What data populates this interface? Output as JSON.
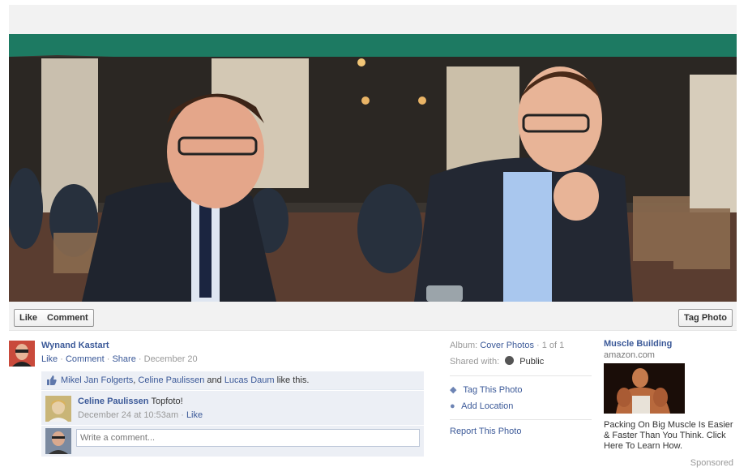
{
  "photo": {
    "alt": "Photo"
  },
  "actions": {
    "like_label": "Like",
    "comment_label": "Comment",
    "tag_photo_label": "Tag Photo"
  },
  "owner": {
    "name": "Wynand Kastart",
    "like_link": "Like",
    "comment_link": "Comment",
    "share_link": "Share",
    "date": "December 20",
    "dot": "·"
  },
  "likes": {
    "people": [
      "Mikel Jan Folgerts",
      "Celine Paulissen",
      "Lucas Daum"
    ],
    "comma": ",",
    "and_text": "and",
    "suffix": "like this."
  },
  "comment": {
    "author": "Celine Paulissen",
    "text": "Topfoto!",
    "timestamp": "December 24 at 10:53am",
    "like_link": "Like"
  },
  "write_comment": {
    "placeholder": "Write a comment..."
  },
  "photo_meta": {
    "album_label": "Album:",
    "album_name": "Cover Photos",
    "position": "· 1 of 1",
    "shared_label": "Shared with:",
    "privacy": "Public",
    "tag_photo": "Tag This Photo",
    "add_location": "Add Location",
    "report": "Report This Photo"
  },
  "ad": {
    "title": "Muscle Building",
    "domain": "amazon.com",
    "body": "Packing On Big Muscle Is Easier & Faster Than You Think. Click Here To Learn How.",
    "sponsored": "Sponsored"
  },
  "colors": {
    "link": "#3b5998",
    "ufi_bg": "#eceff5",
    "awning": "#1d7a62"
  }
}
